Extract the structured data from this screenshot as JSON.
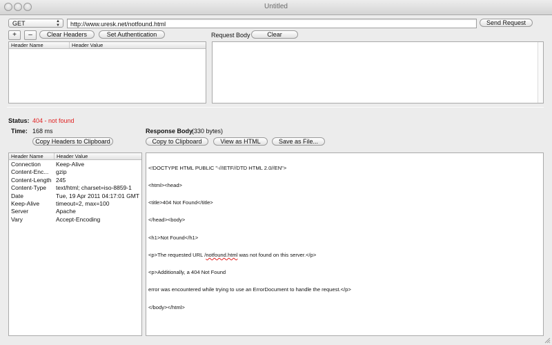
{
  "window": {
    "title": "Untitled"
  },
  "request": {
    "method": "GET",
    "url": "http://www.uresk.net/notfound.html",
    "send_label": "Send Request",
    "add_label": "+",
    "remove_label": "–",
    "clear_headers_label": "Clear Headers",
    "set_auth_label": "Set Authentication",
    "headers_table": {
      "col_name": "Header Name",
      "col_value": "Header Value"
    },
    "body_label": "Request Body",
    "clear_body_label": "Clear"
  },
  "response": {
    "status_label": "Status:",
    "status_value": "404 - not found",
    "status_color": "#e02020",
    "time_label": "Time:",
    "time_value": "168 ms",
    "body_label": "Response Body",
    "body_size": "(330 bytes)",
    "copy_headers_label": "Copy Headers to Clipboard",
    "copy_clipboard_label": "Copy to Clipboard",
    "view_html_label": "View as HTML",
    "save_file_label": "Save as File...",
    "headers_table": {
      "col_name": "Header Name",
      "col_value": "Header Value",
      "rows": [
        {
          "name": "Connection",
          "value": "Keep-Alive"
        },
        {
          "name": "Content-Enc...",
          "value": "gzip"
        },
        {
          "name": "Content-Length",
          "value": "245"
        },
        {
          "name": "Content-Type",
          "value": "text/html; charset=iso-8859-1"
        },
        {
          "name": "Date",
          "value": "Tue, 19 Apr 2011 04:17:01 GMT"
        },
        {
          "name": "Keep-Alive",
          "value": "timeout=2, max=100"
        },
        {
          "name": "Server",
          "value": "Apache"
        },
        {
          "name": "Vary",
          "value": "Accept-Encoding"
        }
      ]
    },
    "body_lines": {
      "l1": "<!DOCTYPE HTML PUBLIC \"-//IETF//DTD HTML 2.0//EN\">",
      "l2": "<html><head>",
      "l3": "<title>404 Not Found</title>",
      "l4": "</head><body>",
      "l5": "<h1>Not Found</h1>",
      "l6_pre": "<p>The requested URL /",
      "l6_err": "notfound.html",
      "l6_post": " was not found on this server.</p>",
      "l7": "<p>Additionally, a 404 Not Found",
      "l8": "error was encountered while trying to use an ErrorDocument to handle the request.</p>",
      "l9": "</body></html>"
    }
  },
  "icons": [
    "close-icon",
    "minimize-icon",
    "zoom-icon",
    "updown-arrows-icon",
    "resize-grip-icon"
  ]
}
